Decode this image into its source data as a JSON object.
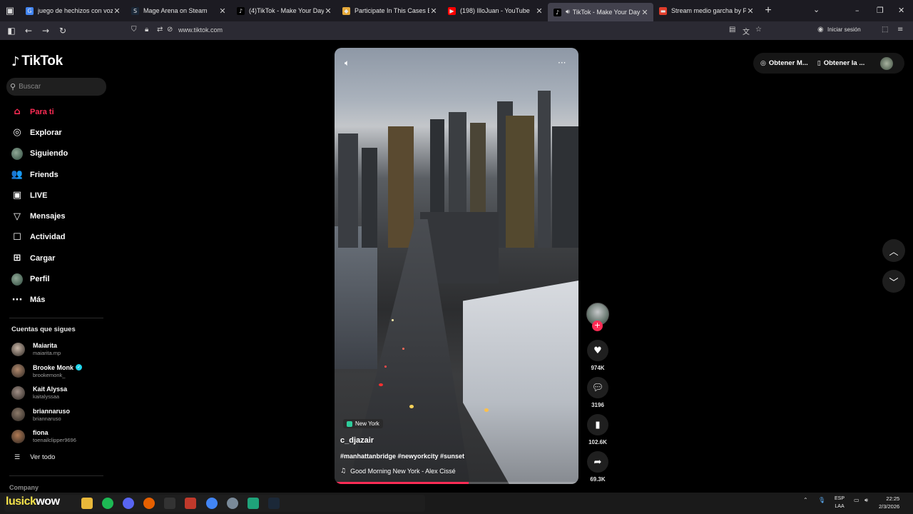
{
  "browser": {
    "tabs": [
      {
        "title": "juego de hechizos con voz - Bu",
        "fav_color": "#4285f4",
        "fav_glyph": "G",
        "active": false,
        "speaker": false
      },
      {
        "title": "Mage Arena on Steam",
        "fav_color": "#1b2838",
        "fav_glyph": "S",
        "active": false,
        "speaker": false
      },
      {
        "title": "(4)TikTok - Make Your Day",
        "fav_color": "#000000",
        "fav_glyph": "♪",
        "active": false,
        "speaker": false
      },
      {
        "title": "Participate In This Cases Battle!",
        "fav_color": "#e5a93a",
        "fav_glyph": "◆",
        "active": false,
        "speaker": false
      },
      {
        "title": "(198) IlloJuan - YouTube",
        "fav_color": "#ff0000",
        "fav_glyph": "▶",
        "active": false,
        "speaker": false
      },
      {
        "title": "TikTok - Make Your Day",
        "fav_color": "#000000",
        "fav_glyph": "♪",
        "active": true,
        "speaker": true
      },
      {
        "title": "Stream medio garcha by PelisC",
        "fav_color": "#e03d2b",
        "fav_glyph": "▬",
        "active": false,
        "speaker": false
      }
    ],
    "url": "www.tiktok.com",
    "signin_label": "Iniciar sesión"
  },
  "sidebar": {
    "logo": "TikTok",
    "search_placeholder": "Buscar",
    "nav": [
      {
        "label": "Para ti",
        "icon": "home-icon",
        "glyph": "⌂",
        "active": true
      },
      {
        "label": "Explorar",
        "icon": "compass-icon",
        "glyph": "◎"
      },
      {
        "label": "Siguiendo",
        "icon": "following-avatar-icon",
        "glyph": ""
      },
      {
        "label": "Friends",
        "icon": "friends-icon",
        "glyph": "👥"
      },
      {
        "label": "LIVE",
        "icon": "live-icon",
        "glyph": "▣"
      },
      {
        "label": "Mensajes",
        "icon": "messages-icon",
        "glyph": "▽"
      },
      {
        "label": "Actividad",
        "icon": "activity-icon",
        "glyph": "☐",
        "badge": "4"
      },
      {
        "label": "Cargar",
        "icon": "upload-icon",
        "glyph": "⊞"
      },
      {
        "label": "Perfil",
        "icon": "profile-avatar-icon",
        "glyph": ""
      },
      {
        "label": "Más",
        "icon": "more-icon",
        "glyph": "···"
      }
    ],
    "following_header": "Cuentas que sigues",
    "following": [
      {
        "name": "Maiarita",
        "username": "maiarita.mp",
        "verified": false,
        "color": "#c9b7a8"
      },
      {
        "name": "Brooke Monk",
        "username": "brookemonk_",
        "verified": true,
        "color": "#b28a6e"
      },
      {
        "name": "Kait Alyssa",
        "username": "kaitalyssaa",
        "verified": false,
        "color": "#a08f86"
      },
      {
        "name": "briannaruso",
        "username": "briannaruso",
        "verified": false,
        "color": "#8c7a6a"
      },
      {
        "name": "fiona",
        "username": "toenailclipper9696",
        "verified": false,
        "color": "#b07a54"
      }
    ],
    "see_all": "Ver todo",
    "company": "Company"
  },
  "video": {
    "location": "New York",
    "author": "c_djazair",
    "caption": "#manhattanbridge #newyorkcity #sunset",
    "music": "Good Morning New York - Alex Cissé",
    "progress": 0.55
  },
  "actions": {
    "likes": "974K",
    "comments": "3196",
    "saves": "102.6K",
    "shares": "69.3K"
  },
  "topright": {
    "coins_label": "Obtener M...",
    "app_label": "Obtener la ..."
  },
  "taskbar": {
    "overlay_yellow": "lusick",
    "overlay_white": "wow",
    "lang_top": "ESP",
    "lang_bottom": "LAA",
    "time": "22:25",
    "date": "2/3/2026"
  }
}
